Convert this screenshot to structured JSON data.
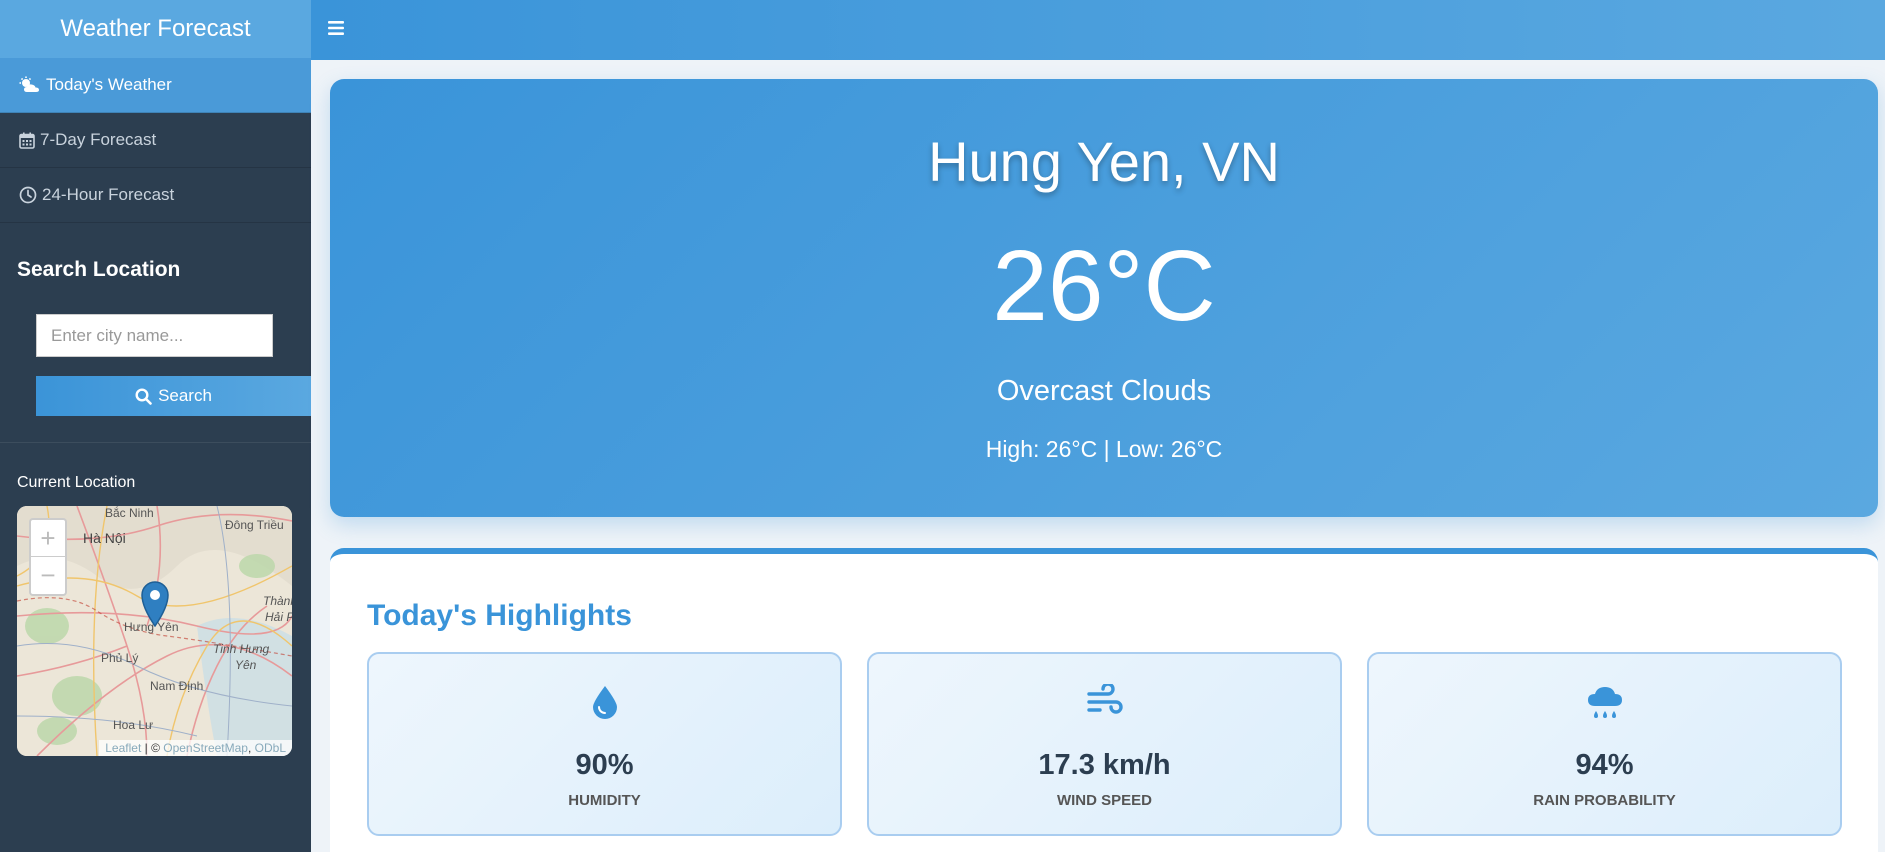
{
  "sidebar": {
    "brand": "Weather Forecast",
    "nav": [
      {
        "label": "Today's Weather",
        "icon": "cloud-sun-icon"
      },
      {
        "label": "7-Day Forecast",
        "icon": "calendar-icon"
      },
      {
        "label": "24-Hour Forecast",
        "icon": "clock-icon"
      }
    ],
    "search_title": "Search Location",
    "search_placeholder": "Enter city name...",
    "search_button": "Search",
    "current_location_title": "Current Location"
  },
  "map": {
    "labels": [
      "Bắc Ninh",
      "Hà Nội",
      "Đông Triều",
      "Hưng Yên",
      "Thành",
      "Hải P",
      "Phủ Lý",
      "Tinh Hưng",
      "Yên",
      "Nam Định",
      "Hoa Lư"
    ],
    "attribution_leaflet": "Leaflet",
    "attribution_sep": " | © ",
    "attribution_osm": "OpenStreetMap",
    "attribution_comma": ", ",
    "attribution_odbl": "ODbL",
    "zoom_in": "+",
    "zoom_out": "−"
  },
  "weather": {
    "city": "Hung Yen, VN",
    "temperature": "26°C",
    "condition": "Overcast Clouds",
    "high_low": "High: 26°C | Low: 26°C"
  },
  "highlights": {
    "title": "Today's Highlights",
    "cards": [
      {
        "value": "90%",
        "label": "HUMIDITY",
        "icon": "droplet-icon"
      },
      {
        "value": "17.3 km/h",
        "label": "WIND SPEED",
        "icon": "wind-icon"
      },
      {
        "value": "94%",
        "label": "RAIN PROBABILITY",
        "icon": "cloud-rain-icon"
      }
    ]
  },
  "colors": {
    "accent": "#3a94d9",
    "sidebar_bg": "#2c3e50",
    "active_nav": "#4a9ad8"
  }
}
